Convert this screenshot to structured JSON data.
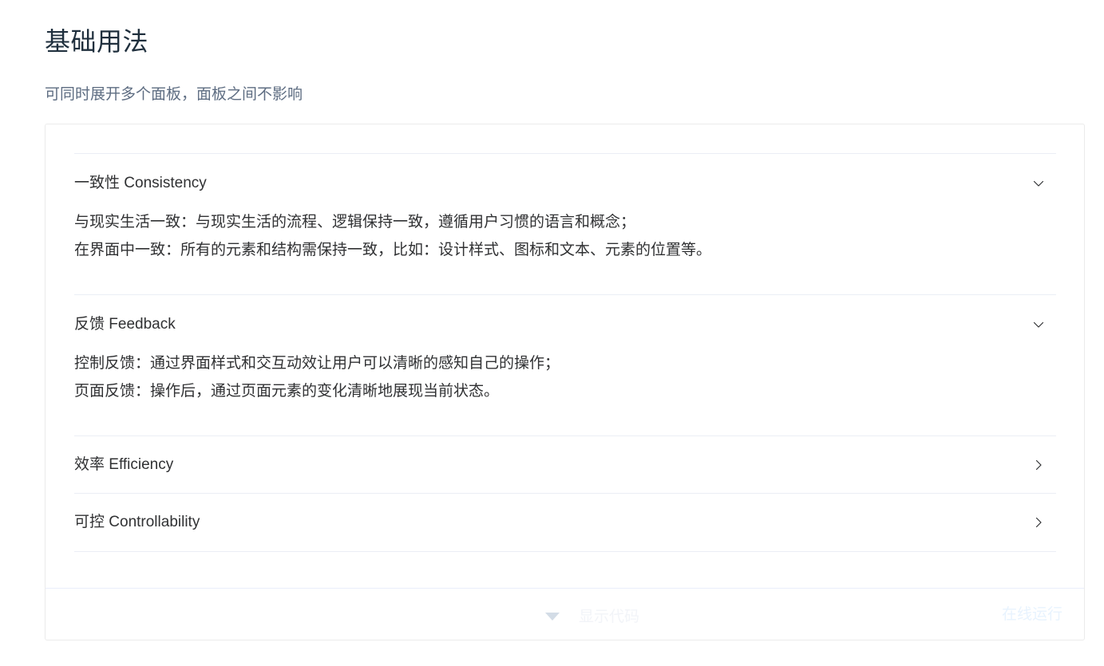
{
  "section": {
    "title": "基础用法",
    "description": "可同时展开多个面板，面板之间不影响"
  },
  "collapse": {
    "items": [
      {
        "title": "一致性 Consistency",
        "expanded": true,
        "arrow_icon": "chevron-down-icon",
        "content": [
          "与现实生活一致：与现实生活的流程、逻辑保持一致，遵循用户习惯的语言和概念；",
          "在界面中一致：所有的元素和结构需保持一致，比如：设计样式、图标和文本、元素的位置等。"
        ]
      },
      {
        "title": "反馈 Feedback",
        "expanded": true,
        "arrow_icon": "chevron-down-icon",
        "content": [
          "控制反馈：通过界面样式和交互动效让用户可以清晰的感知自己的操作；",
          "页面反馈：操作后，通过页面元素的变化清晰地展现当前状态。"
        ]
      },
      {
        "title": "效率 Efficiency",
        "expanded": false,
        "arrow_icon": "chevron-right-icon"
      },
      {
        "title": "可控 Controllability",
        "expanded": false,
        "arrow_icon": "chevron-right-icon"
      }
    ]
  },
  "demo_control": {
    "toggle_label": "显示代码",
    "toggle_icon": "caret-down-icon",
    "online_run_label": "在线运行"
  },
  "colors": {
    "title": "#1f2f3d",
    "description": "#5e6d82",
    "border": "#ebeef5",
    "text": "#303133",
    "arrow": "#303133"
  }
}
